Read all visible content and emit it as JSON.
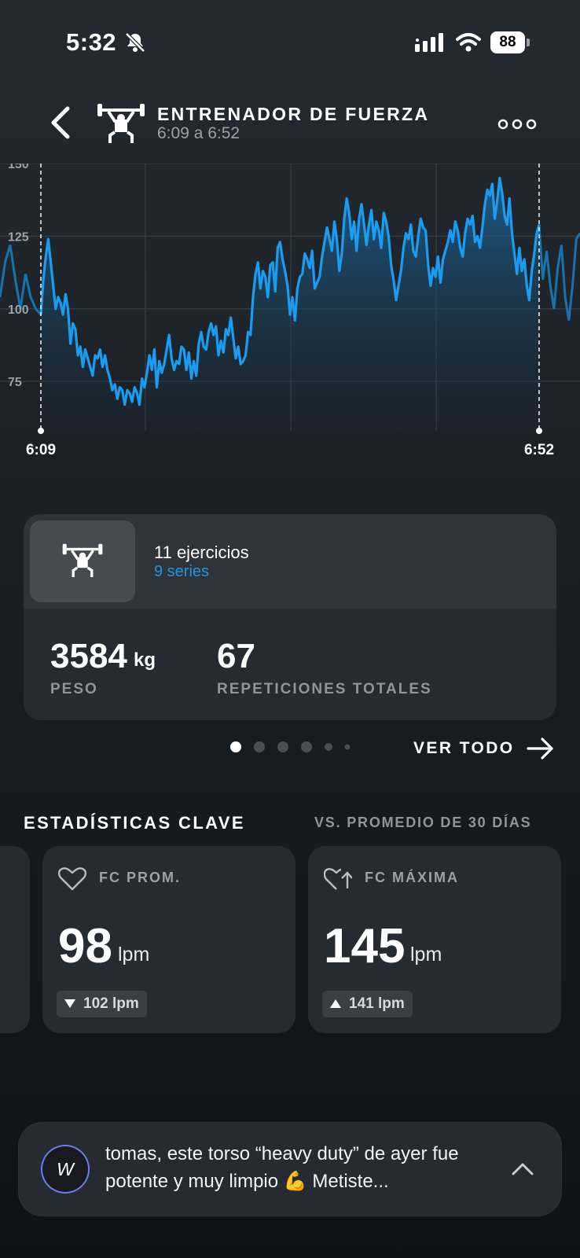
{
  "status_bar": {
    "time": "5:32",
    "battery": "88"
  },
  "header": {
    "title": "ENTRENADOR DE FUERZA",
    "subtitle": "6:09 a 6:52"
  },
  "chart_data": {
    "type": "area",
    "y_ticks": [
      "150",
      "125",
      "100",
      "75"
    ],
    "ylim": [
      58,
      150
    ],
    "time_markers": [
      "6:09",
      "6:52"
    ],
    "series": [
      {
        "values": [
          98,
          110,
          118,
          124,
          116,
          108,
          100,
          104,
          102,
          98,
          105,
          100,
          88,
          95,
          93,
          84,
          87,
          80,
          86,
          83,
          80,
          77,
          84,
          83,
          86,
          80,
          84,
          79,
          76,
          72,
          74,
          69,
          73,
          72,
          67,
          72,
          71,
          68,
          73,
          71,
          67,
          76,
          73,
          78,
          84,
          79,
          86,
          73,
          82,
          78,
          81,
          86,
          91,
          83,
          79,
          82,
          81,
          87,
          86,
          79,
          85,
          76,
          82,
          77,
          88,
          92,
          87,
          86,
          92,
          95,
          91,
          94,
          84,
          89,
          85,
          93,
          91,
          97,
          90,
          83,
          87,
          81,
          82,
          84,
          92,
          91,
          104,
          112,
          116,
          107,
          113,
          111,
          104,
          115,
          116,
          106,
          121,
          123,
          117,
          113,
          108,
          98,
          104,
          96,
          107,
          111,
          112,
          119,
          117,
          114,
          120,
          107,
          109,
          111,
          118,
          123,
          128,
          124,
          120,
          130,
          124,
          113,
          119,
          131,
          138,
          133,
          124,
          130,
          120,
          131,
          136,
          129,
          122,
          129,
          134,
          124,
          130,
          127,
          121,
          133,
          130,
          125,
          115,
          110,
          103,
          108,
          113,
          121,
          126,
          124,
          129,
          120,
          118,
          125,
          131,
          128,
          127,
          115,
          108,
          114,
          111,
          118,
          109,
          117,
          120,
          123,
          127,
          123,
          130,
          127,
          121,
          118,
          126,
          131,
          129,
          132,
          123,
          125,
          121,
          128,
          136,
          141,
          139,
          143,
          131,
          137,
          145,
          140,
          132,
          129,
          138,
          126,
          119,
          112,
          121,
          113,
          117,
          108,
          103,
          113,
          119,
          126,
          129
        ]
      }
    ]
  },
  "workout": {
    "exercises": "11 ejercicios",
    "series": "9 series",
    "weight_value": "3584",
    "weight_unit": "kg",
    "weight_label": "PESO",
    "reps_value": "67",
    "reps_label": "REPETICIONES TOTALES"
  },
  "pager": {
    "view_all": "VER TODO",
    "page_count": 6,
    "active_page": 1
  },
  "key_stats": {
    "title": "ESTADÍSTICAS CLAVE",
    "subtitle": "VS. PROMEDIO DE 30 DÍAS",
    "cards": [
      {
        "label": "FC PROM.",
        "value": "98",
        "unit": "lpm",
        "delta": "102 lpm",
        "icon": "heart-icon",
        "trend": "down"
      },
      {
        "label": "FC MÁXIMA",
        "value": "145",
        "unit": "lpm",
        "delta": "141 lpm",
        "icon": "heart-up-icon",
        "trend": "up"
      }
    ]
  },
  "coach": {
    "message": "tomas, este torso “heavy duty” de ayer fue potente y muy limpio 💪  Metiste...",
    "logo": "W"
  },
  "colors": {
    "accent": "#1e96e8",
    "line": "#1a9cf0",
    "card": "#262b31"
  }
}
